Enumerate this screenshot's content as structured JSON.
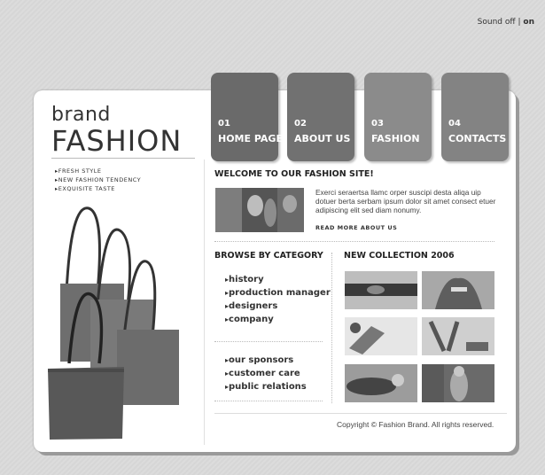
{
  "topbar": {
    "sound_label": "Sound",
    "off_label": "off",
    "separator": "|",
    "on_label": "on"
  },
  "logo": {
    "line1": "brand",
    "line2": "FASHION"
  },
  "taglines": [
    "FRESH STYLE",
    "NEW FASHION TENDENCY",
    "EXQUISITE TASTE"
  ],
  "tabs": [
    {
      "num": "01",
      "label": "HOME PAGE",
      "color": "#6a6a6a"
    },
    {
      "num": "02",
      "label": "ABOUT US",
      "color": "#717171"
    },
    {
      "num": "03",
      "label": "FASHION",
      "color": "#8b8b8b"
    },
    {
      "num": "04",
      "label": "CONTACTS",
      "color": "#838383"
    }
  ],
  "welcome": {
    "title": "WELCOME TO OUR FASHION SITE!",
    "text": "Exerci seraertsa llamc orper suscipi desta aliqa uip dotuer berta serbam ipsum dolor sit amet consect etuer adipiscing elit sed diam nonumy.",
    "read_more": "READ MORE ABOUT US"
  },
  "browse": {
    "title": "BROWSE BY CATEGORY",
    "group1": [
      "history",
      "production manager",
      "designers",
      "company"
    ],
    "group2": [
      "our sponsors",
      "customer care",
      "public relations"
    ]
  },
  "collection": {
    "title": "NEW COLLECTION 2006"
  },
  "footer": {
    "copyright": "Copyright © Fashion Brand. All rights reserved."
  }
}
